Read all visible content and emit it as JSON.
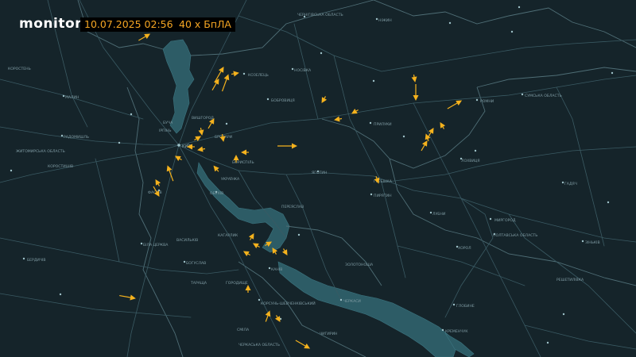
{
  "header": {
    "brand": "monitor",
    "datetime": "10.07.2025 02:56",
    "drone_count": "40 х БпЛА"
  },
  "colors": {
    "background": "#15242a",
    "water": "#2d5c66",
    "roads": "#3a5a63",
    "borders": "#4f6e76",
    "drone": "#f5b21d",
    "brand_text": "#ffffff",
    "chip_text": "#f5a623"
  },
  "icons": {
    "drone": "drone-arrow-icon",
    "settlement": "settlement-dot-icon"
  },
  "map": {
    "place_labels": [
      "ЧЕРНІГІВСЬКА ОБЛАСТЬ",
      "НІЖИН",
      "КОЗЕЛЕЦЬ",
      "НОСІВКА",
      "БОБРОВИЦЯ",
      "ВИШГОРОД",
      "КИЇВ",
      "БРОВАРИ",
      "БОРИСПІЛЬ",
      "ІРПІНЬ",
      "БУЧА",
      "ФАСТІВ",
      "БІЛА ЦЕРКВА",
      "ОБУХІВ",
      "УКРАЇНКА",
      "КАНІВ",
      "ЧЕРКАСИ",
      "ПЕРЕЯСЛАВ",
      "ЯГОТИН",
      "ПРИЛУКИ",
      "ПИРЯТИН",
      "ЛУБНИ",
      "ХОРОЛ",
      "ГРЕБІНКА",
      "МИРГОРОД",
      "ПОЛТАВСЬКА ОБЛАСТЬ",
      "РОМНИ",
      "СУМСЬКА ОБЛАСТЬ",
      "ЖИТОМИРСЬКА ОБЛАСТЬ",
      "КОРОСТЕНЬ",
      "МАЛИН",
      "РАДОМИШЛЬ",
      "БЕРДИЧІВ",
      "КОРОСТИШІВ",
      "ЧЕРКАСЬКА ОБЛАСТЬ",
      "СМІЛА",
      "ЗОЛОТОНОША",
      "ЧИГИРИН",
      "КРЕМЕНЧУК",
      "ГОРОДИЩЕ",
      "КОРСУНЬ-ШЕВЧЕНКІВСЬКИЙ",
      "БОГУСЛАВ",
      "КАГАРЛИК",
      "ТАРАЩА",
      "ВАСИЛЬКІВ",
      "ГЛОБИНЕ",
      "ГАДЯЧ",
      "ЛОХВИЦЯ",
      "ЗІНЬКІВ",
      "РЕШЕТИЛІВКА"
    ]
  }
}
